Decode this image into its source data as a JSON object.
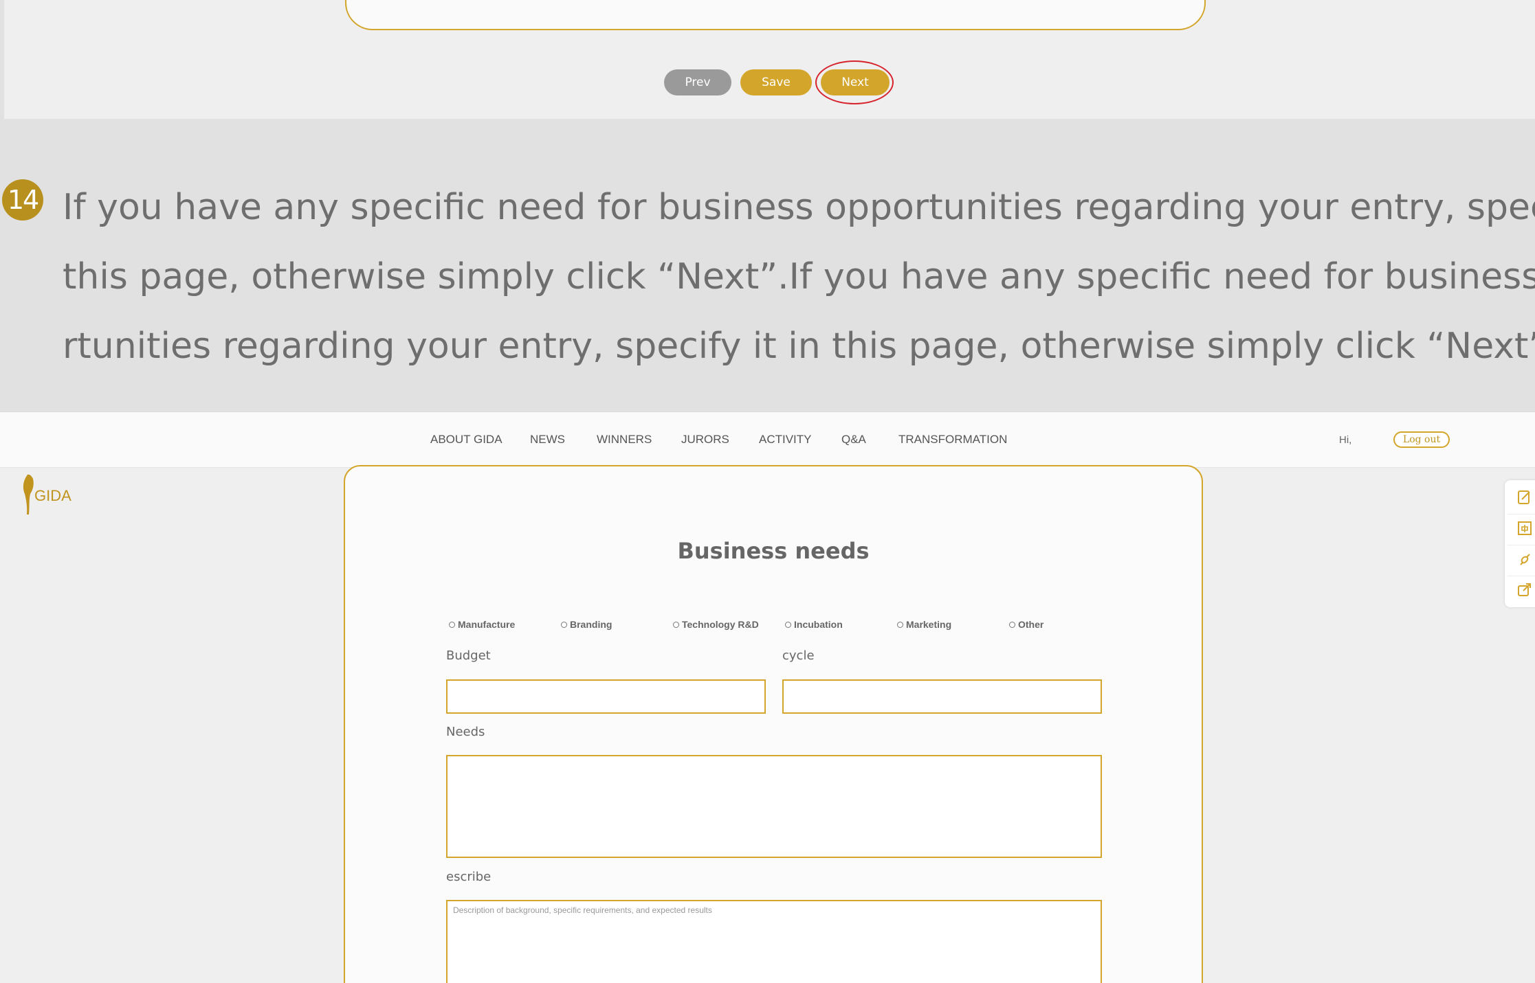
{
  "top_buttons": {
    "prev_label": "Prev",
    "save_label": "Save",
    "next_label": "Next"
  },
  "instruction": {
    "step_number": "14",
    "line1": "If you have any specific need for business opportunities regarding your entry, specify it in",
    "line2": "this page, otherwise simply click “Next”.If you have any specific need for business oppo-",
    "line3": "rtunities regarding your entry, specify it in this page, otherwise simply click “Next”."
  },
  "nav": {
    "items": [
      "ABOUT GIDA",
      "NEWS",
      "WINNERS",
      "JURORS",
      "ACTIVITY",
      "Q&A",
      "TRANSFORMATION"
    ],
    "greeting": "Hi,",
    "logout_label": "Log out"
  },
  "logo": {
    "text": "GIDA"
  },
  "form": {
    "title": "Business needs",
    "options": [
      "Manufacture",
      "Branding",
      "Technology R&D",
      "Incubation",
      "Marketing",
      "Other"
    ],
    "budget_label": "Budget",
    "cycle_label": "cycle",
    "needs_label": "Needs",
    "describe_label": "escribe",
    "describe_placeholder": "Description of background, specific requirements, and expected results"
  },
  "side_toolbar": {
    "icons": [
      "edit-icon",
      "chinese-language-icon",
      "phone-icon",
      "share-icon"
    ]
  },
  "colors": {
    "accent": "#d4a52b",
    "highlight_ring": "#d6232c",
    "prev_button": "#9a9a9a",
    "step_badge": "#b8901d"
  }
}
